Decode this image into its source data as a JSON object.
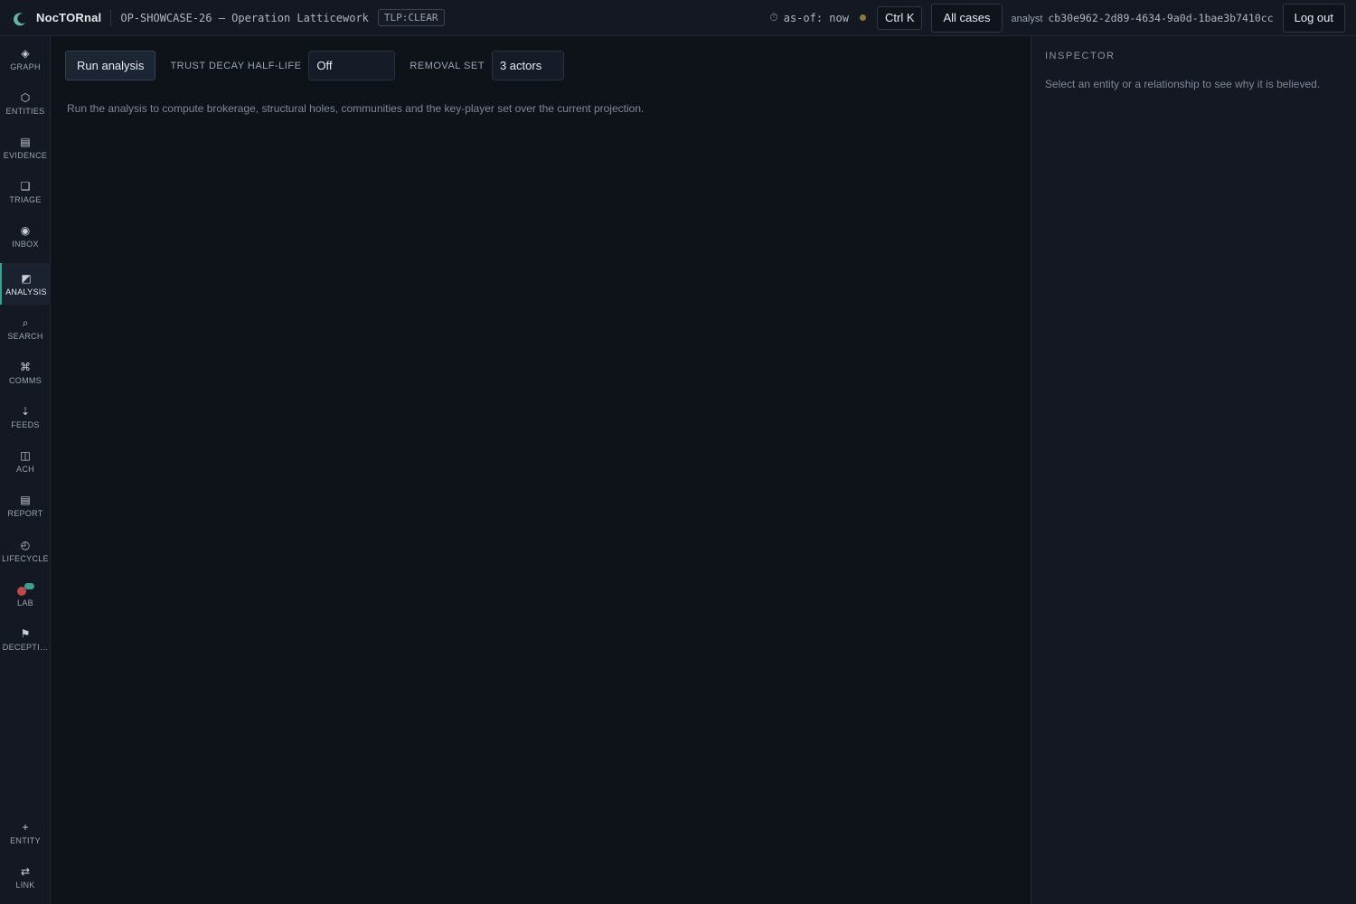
{
  "header": {
    "brand": "NocTORnal",
    "case_title": "OP-SHOWCASE-26 — Operation Latticework",
    "tlp": "TLP:CLEAR",
    "as_of": "as-of: now",
    "command_shortcut": "Ctrl K",
    "all_cases_label": "All cases",
    "analyst_label": "analyst",
    "analyst_id": "cb30e962-2d89-4634-9a0d-1bae3b7410cc",
    "logout_label": "Log out"
  },
  "sidebar": {
    "items": [
      {
        "label": "GRAPH",
        "icon": "◈"
      },
      {
        "label": "ENTITIES",
        "icon": "⬡"
      },
      {
        "label": "EVIDENCE",
        "icon": "▤"
      },
      {
        "label": "TRIAGE",
        "icon": "❏"
      },
      {
        "label": "INBOX",
        "icon": "◉"
      },
      {
        "label": "ANALYSIS",
        "icon": "◩"
      },
      {
        "label": "SEARCH",
        "icon": "⌕"
      },
      {
        "label": "COMMS",
        "icon": "⌘"
      },
      {
        "label": "FEEDS",
        "icon": "⇣"
      },
      {
        "label": "ACH",
        "icon": "◫"
      },
      {
        "label": "REPORT",
        "icon": "▤"
      },
      {
        "label": "LIFECYCLE",
        "icon": "◴"
      },
      {
        "label": "LAB",
        "icon": "⚗"
      },
      {
        "label": "DECEPTI…",
        "icon": "⚑"
      }
    ],
    "active": "ANALYSIS",
    "bottom": [
      {
        "label": "ENTITY",
        "icon": "+"
      },
      {
        "label": "LINK",
        "icon": "⇄"
      }
    ]
  },
  "analysis": {
    "run_label": "Run analysis",
    "trust_decay_label": "TRUST DECAY HALF-LIFE",
    "trust_decay_value": "Off",
    "removal_set_label": "REMOVAL SET",
    "removal_set_value": "3 actors",
    "hint": "Run the analysis to compute brokerage, structural holes, communities and the key-player set over the current projection."
  },
  "inspector": {
    "title": "INSPECTOR",
    "hint": "Select an entity or a relationship to see why it is believed."
  },
  "colors": {
    "accent": "#3aa090",
    "background": "#0e1219",
    "panel": "#131823",
    "status_dot": "#8a7a3a"
  }
}
